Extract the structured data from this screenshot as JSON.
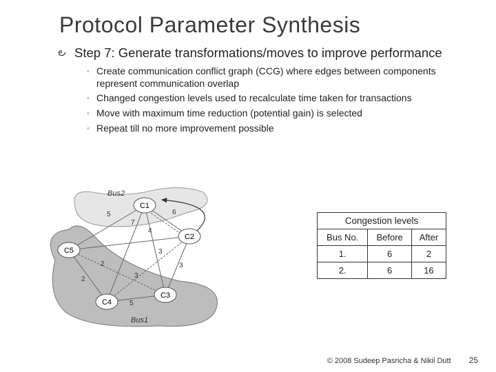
{
  "title": "Protocol Parameter Synthesis",
  "step": {
    "label": "Step 7: Generate transformations/moves to improve performance",
    "bullets": [
      "Create communication conflict graph (CCG) where edges between components represent communication overlap",
      "Changed congestion levels used to recalculate time taken for transactions",
      "Move with maximum time reduction (potential gain) is selected",
      "Repeat till no more improvement possible"
    ]
  },
  "diagram": {
    "buses": [
      "Bus2",
      "Bus1"
    ],
    "nodes": [
      "C1",
      "C2",
      "C3",
      "C4",
      "C5"
    ],
    "edge_weights": [
      "5",
      "6",
      "7",
      "4",
      "3",
      "3",
      "3",
      "2",
      "2",
      "5"
    ]
  },
  "table": {
    "title": "Congestion levels",
    "headers": [
      "Bus No.",
      "Before",
      "After"
    ],
    "rows": [
      [
        "1.",
        "6",
        "2"
      ],
      [
        "2.",
        "6",
        "16"
      ]
    ]
  },
  "footer": {
    "copyright": "© 2008 Sudeep Pasricha  & Nikil Dutt",
    "page": "25"
  }
}
